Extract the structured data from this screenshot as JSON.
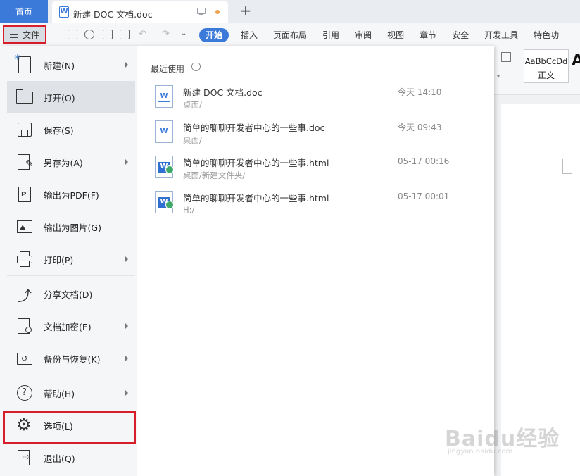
{
  "tabs": {
    "home": "首页",
    "doc_title": "新建 DOC 文档.doc",
    "add": "+"
  },
  "ribbon": {
    "file_label": "文件",
    "tabs": [
      "开始",
      "插入",
      "页面布局",
      "引用",
      "审阅",
      "视图",
      "章节",
      "安全",
      "开发工具",
      "特色功"
    ]
  },
  "styles": {
    "sample": "AaBbCcDd",
    "name": "正文",
    "big": "A"
  },
  "menu": {
    "items": [
      {
        "label": "新建(N)",
        "icon": "new-doc-icon",
        "submenu": true
      },
      {
        "label": "打开(O)",
        "icon": "folder-open-icon",
        "submenu": false
      },
      {
        "label": "保存(S)",
        "icon": "save-icon",
        "submenu": false
      },
      {
        "label": "另存为(A)",
        "icon": "save-as-icon",
        "submenu": true
      },
      {
        "label": "输出为PDF(F)",
        "icon": "pdf-icon",
        "submenu": false
      },
      {
        "label": "输出为图片(G)",
        "icon": "image-icon",
        "submenu": false
      },
      {
        "label": "打印(P)",
        "icon": "print-icon",
        "submenu": true
      },
      {
        "label": "分享文档(D)",
        "icon": "share-icon",
        "submenu": false
      },
      {
        "label": "文档加密(E)",
        "icon": "encrypt-icon",
        "submenu": true
      },
      {
        "label": "备份与恢复(K)",
        "icon": "backup-icon",
        "submenu": true
      },
      {
        "label": "帮助(H)",
        "icon": "help-icon",
        "submenu": true
      },
      {
        "label": "选项(L)",
        "icon": "gear-icon",
        "submenu": false
      },
      {
        "label": "退出(Q)",
        "icon": "exit-icon",
        "submenu": false
      }
    ]
  },
  "recent": {
    "title": "最近使用",
    "files": [
      {
        "name": "新建 DOC 文档.doc",
        "path": "桌面/",
        "time": "今天 14:10",
        "type": "doc"
      },
      {
        "name": "简单的聊聊开发者中心的一些事.doc",
        "path": "桌面/",
        "time": "今天 09:43",
        "type": "doc"
      },
      {
        "name": "简单的聊聊开发者中心的一些事.html",
        "path": "桌面/新建文件夹/",
        "time": "05-17 00:16",
        "type": "html"
      },
      {
        "name": "简单的聊聊开发者中心的一些事.html",
        "path": "H:/",
        "time": "05-17 00:01",
        "type": "html"
      }
    ]
  },
  "watermark": {
    "main": "Baidu经验",
    "sub": "jingyan.baidu.com"
  },
  "colors": {
    "accent": "#3b7ad9",
    "highlight": "#d81e2a"
  }
}
